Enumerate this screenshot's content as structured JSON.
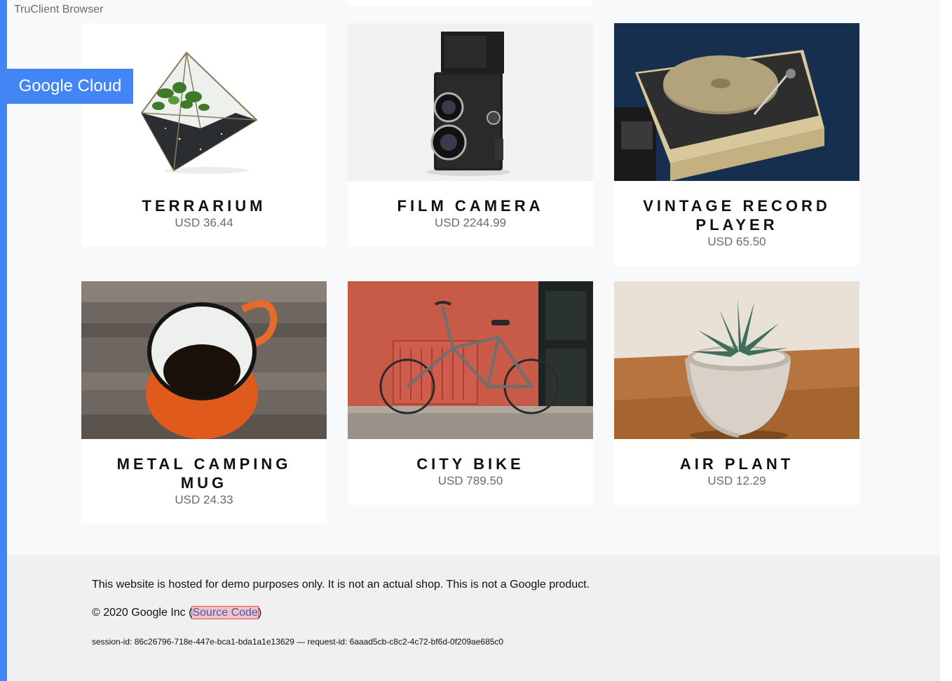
{
  "browser_label": "TruClient Browser",
  "brand": {
    "label": "Google Cloud",
    "color": "#4285f4"
  },
  "products": [
    {
      "name": "TERRARIUM",
      "price": "USD 36.44"
    },
    {
      "name": "FILM CAMERA",
      "price": "USD 2244.99"
    },
    {
      "name": "VINTAGE RECORD PLAYER",
      "price": "USD 65.50"
    },
    {
      "name": "METAL CAMPING MUG",
      "price": "USD 24.33"
    },
    {
      "name": "CITY BIKE",
      "price": "USD 789.50"
    },
    {
      "name": "AIR PLANT",
      "price": "USD 12.29"
    }
  ],
  "footer": {
    "disclaimer": "This website is hosted for demo purposes only. It is not an actual shop. This is not a Google product.",
    "copyright_prefix": "© 2020 Google Inc (",
    "source_link": "Source Code",
    "copyright_suffix": ")",
    "session": "session-id: 86c26796-718e-447e-bca1-bda1a1e13629 — request-id: 6aaad5cb-c8c2-4c72-bf6d-0f209ae685c0"
  }
}
